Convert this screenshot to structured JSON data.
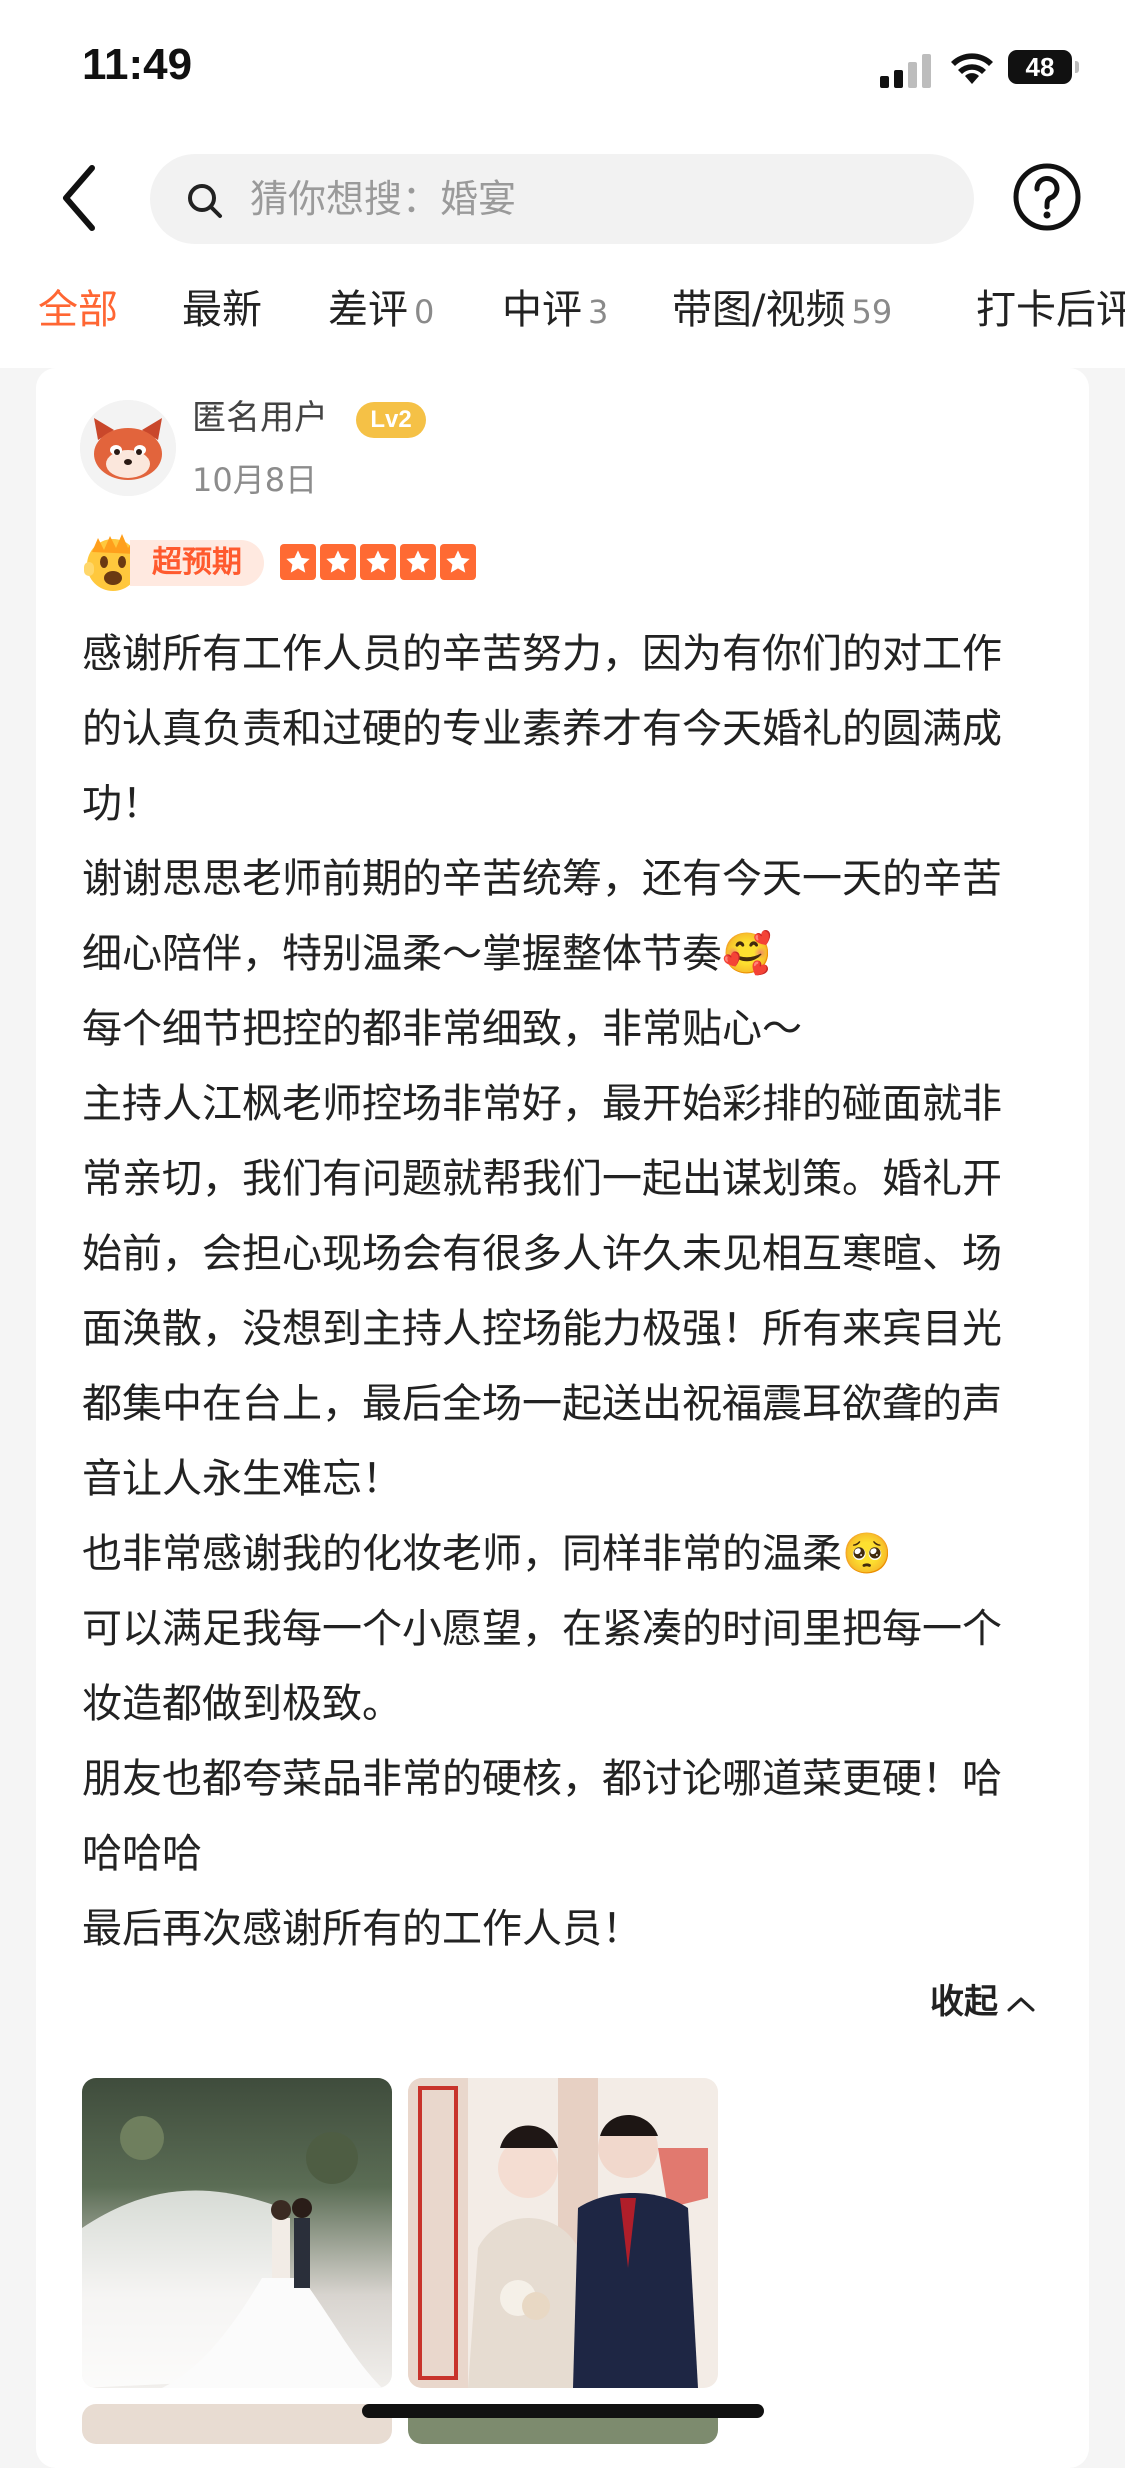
{
  "status_bar": {
    "time": "11:49",
    "battery": "48"
  },
  "search": {
    "placeholder": "猜你想搜：婚宴"
  },
  "tabs": [
    {
      "label": "全部",
      "count": ""
    },
    {
      "label": "最新",
      "count": ""
    },
    {
      "label": "差评",
      "count": "0"
    },
    {
      "label": "中评",
      "count": "3"
    },
    {
      "label": "带图/视频",
      "count": "59"
    },
    {
      "label": "打卡后评",
      "count": ""
    }
  ],
  "review": {
    "user": "匿名用户",
    "level": "Lv2",
    "date": "10月8日",
    "rating_label": "超预期",
    "stars": 5,
    "paragraphs": [
      "感谢所有工作人员的辛苦努力，因为有你们的对工作的认真负责和过硬的专业素养才有今天婚礼的圆满成功！",
      "谢谢思思老师前期的辛苦统筹，还有今天一天的辛苦细心陪伴，特别温柔～掌握整体节奏🥰",
      "每个细节把控的都非常细致，非常贴心～",
      "主持人江枫老师控场非常好，最开始彩排的碰面就非常亲切，我们有问题就帮我们一起出谋划策。婚礼开始前，会担心现场会有很多人许久未见相互寒暄、场面涣散，没想到主持人控场能力极强！所有来宾目光都集中在台上，最后全场一起送出祝福震耳欲聋的声音让人永生难忘！",
      "也非常感谢我的化妆老师，同样非常的温柔🥺",
      "可以满足我每一个小愿望，在紧凑的时间里把每一个妆造都做到极致。",
      "朋友也都夸菜品非常的硬核，都讨论哪道菜更硬！哈哈哈哈",
      "最后再次感谢所有的工作人员！"
    ],
    "collapse_label": "收起"
  },
  "colors": {
    "accent": "#ff6633",
    "level_badge": "#f5c146"
  }
}
